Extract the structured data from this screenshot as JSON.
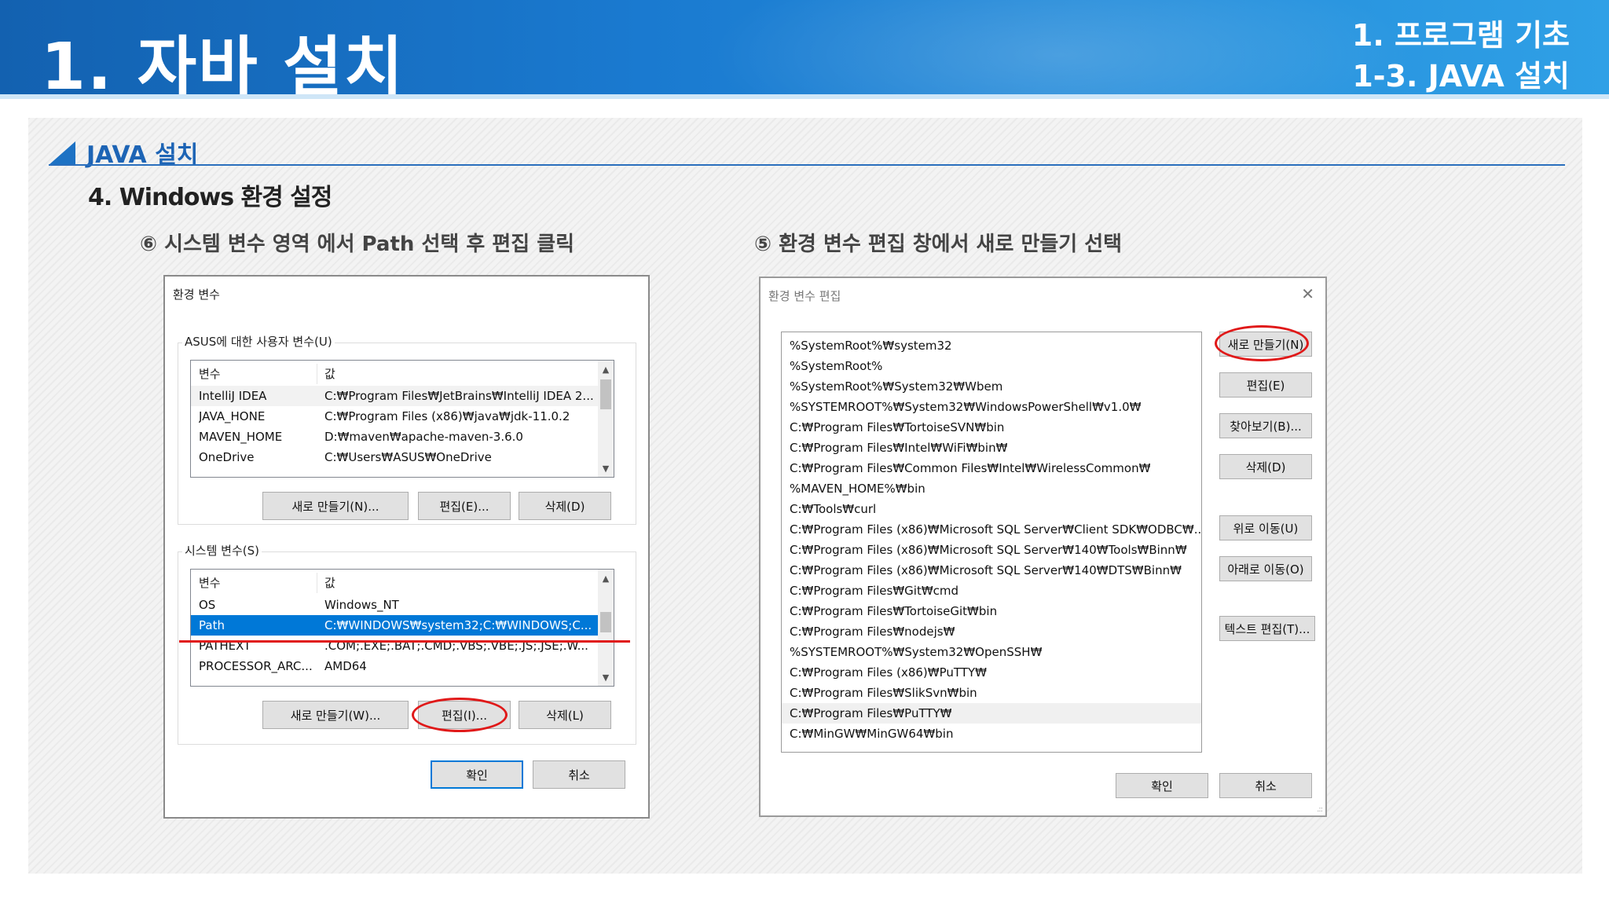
{
  "header": {
    "title": "1. 자바 설치",
    "subtitle_line1": "1. 프로그램 기초",
    "subtitle_line2": "1-3. JAVA 설치"
  },
  "section": {
    "title": "JAVA 설치",
    "step": "4.  Windows 환경 설정"
  },
  "captions": {
    "left": "⑥ 시스템 변수 영역 에서 Path 선택 후 편집 클릭",
    "right": "⑤ 환경 변수 편집 창에서 새로 만들기 선택"
  },
  "env_dialog": {
    "title": "환경 변수",
    "user_group_label": "ASUS에 대한 사용자 변수(U)",
    "columns": [
      "변수",
      "값"
    ],
    "user_vars": [
      {
        "name": "IntelliJ IDEA",
        "value": "C:₩Program Files₩JetBrains₩IntelliJ IDEA 2..."
      },
      {
        "name": "JAVA_HONE",
        "value": "C:₩Program Files (x86)₩java₩jdk-11.0.2"
      },
      {
        "name": "MAVEN_HOME",
        "value": "D:₩maven₩apache-maven-3.6.0"
      },
      {
        "name": "OneDrive",
        "value": "C:₩Users₩ASUS₩OneDrive"
      }
    ],
    "user_buttons": {
      "new": "새로 만들기(N)...",
      "edit": "편집(E)...",
      "delete": "삭제(D)"
    },
    "system_group_label": "시스템 변수(S)",
    "system_vars": [
      {
        "name": "OS",
        "value": "Windows_NT"
      },
      {
        "name": "Path",
        "value": "C:₩WINDOWS₩system32;C:₩WINDOWS;C..."
      },
      {
        "name": "PATHEXT",
        "value": ".COM;.EXE;.BAT;.CMD;.VBS;.VBE;.JS;.JSE;.W..."
      },
      {
        "name": "PROCESSOR_ARC...",
        "value": "AMD64"
      }
    ],
    "selected_system_var": "Path",
    "system_buttons": {
      "new": "새로 만들기(W)...",
      "edit": "편집(I)...",
      "delete": "삭제(L)"
    },
    "ok": "확인",
    "cancel": "취소",
    "scroll_up": "▲",
    "scroll_down": "▼"
  },
  "edit_dialog": {
    "title": "환경 변수 편집",
    "close": "✕",
    "paths": [
      "%SystemRoot%₩system32",
      "%SystemRoot%",
      "%SystemRoot%₩System32₩Wbem",
      "%SYSTEMROOT%₩System32₩WindowsPowerShell₩v1.0₩",
      "C:₩Program Files₩TortoiseSVN₩bin",
      "C:₩Program Files₩Intel₩WiFi₩bin₩",
      "C:₩Program Files₩Common Files₩Intel₩WirelessCommon₩",
      "%MAVEN_HOME%₩bin",
      "C:₩Tools₩curl",
      "C:₩Program Files (x86)₩Microsoft SQL Server₩Client SDK₩ODBC₩...",
      "C:₩Program Files (x86)₩Microsoft SQL Server₩140₩Tools₩Binn₩",
      "C:₩Program Files (x86)₩Microsoft SQL Server₩140₩DTS₩Binn₩",
      "C:₩Program Files₩Git₩cmd",
      "C:₩Program Files₩TortoiseGit₩bin",
      "C:₩Program Files₩nodejs₩",
      "%SYSTEMROOT%₩System32₩OpenSSH₩",
      "C:₩Program Files (x86)₩PuTTY₩",
      "C:₩Program Files₩SlikSvn₩bin",
      "C:₩Program Files₩PuTTY₩",
      "C:₩MinGW₩MinGW64₩bin"
    ],
    "highlighted_path": "C:₩Program Files₩PuTTY₩",
    "buttons": {
      "new": "새로 만들기(N)",
      "edit": "편집(E)",
      "browse": "찾아보기(B)...",
      "delete": "삭제(D)",
      "move_up": "위로 이동(U)",
      "move_down": "아래로 이동(O)",
      "edit_text": "텍스트 편집(T)..."
    },
    "ok": "확인",
    "cancel": "취소",
    "resize_grip": ".::"
  },
  "colors": {
    "banner_start": "#1361b0",
    "banner_end": "#2fa0e6",
    "selection": "#0078d7",
    "annotation_red": "#e01919",
    "section_blue": "#1d64b5"
  }
}
